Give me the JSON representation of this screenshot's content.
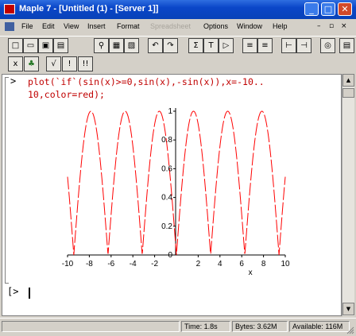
{
  "window": {
    "title": "Maple 7 - [Untitled (1) - [Server 1]]",
    "min": "_",
    "max": "□",
    "close": "✕"
  },
  "menu": {
    "items": [
      "File",
      "Edit",
      "View",
      "Insert",
      "Format",
      "Spreadsheet",
      "Options",
      "Window",
      "Help"
    ],
    "mdi": {
      "min": "–",
      "restore": "▫",
      "close": "×"
    }
  },
  "toolbar": {
    "buttons": [
      "□",
      "▭",
      "▣",
      "▤",
      "⚲",
      "▦",
      "▧",
      "↶",
      "↷",
      "Σ",
      "T",
      "▷",
      "≡",
      "≡",
      "⊢",
      "⊣",
      "◎",
      "▤"
    ]
  },
  "toolbar2": {
    "buttons": [
      "x",
      "♣",
      "√",
      "!",
      "!!"
    ]
  },
  "document": {
    "input_prompt": ">",
    "command_line1": "plot(`if`(sin(x)>=0,sin(x),-sin(x)),x=-10..",
    "command_line2": "10,color=red);",
    "new_prompt": "[>"
  },
  "chart_data": {
    "type": "line",
    "series": [
      {
        "color": "#ff0000",
        "function": "abs(sin(x))"
      }
    ],
    "xlim": [
      -10,
      10
    ],
    "ylim": [
      0,
      1
    ],
    "xticks": [
      "-10",
      "-8",
      "-6",
      "-4",
      "-2",
      "2",
      "4",
      "6",
      "8",
      "10"
    ],
    "yticks": [
      "1",
      "0.8",
      "0.6",
      "0.4",
      "0.2",
      "0"
    ],
    "xlabel": "x",
    "style": "dashed-line"
  },
  "status": {
    "time": "Time: 1.8s",
    "bytes": "Bytes: 3.62M",
    "available": "Available: 116M"
  }
}
